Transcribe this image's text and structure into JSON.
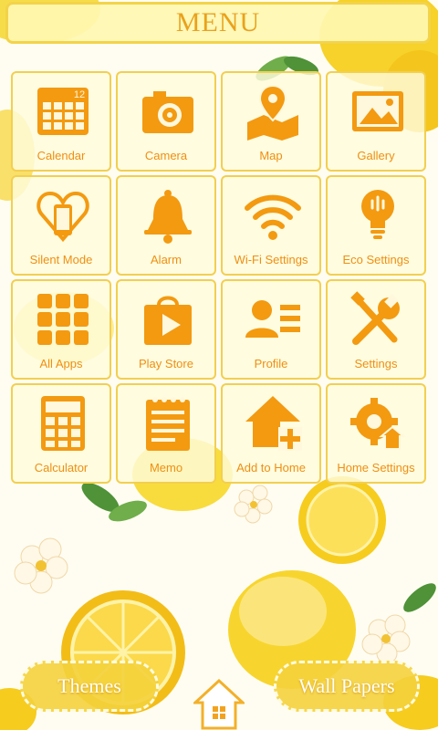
{
  "header": {
    "title": "MENU"
  },
  "apps": [
    {
      "label": "Calendar",
      "icon": "calendar-icon",
      "badge": "12"
    },
    {
      "label": "Camera",
      "icon": "camera-icon"
    },
    {
      "label": "Map",
      "icon": "map-icon"
    },
    {
      "label": "Gallery",
      "icon": "gallery-icon"
    },
    {
      "label": "Silent Mode",
      "icon": "silent-mode-icon"
    },
    {
      "label": "Alarm",
      "icon": "alarm-icon"
    },
    {
      "label": "Wi-Fi Settings",
      "icon": "wifi-icon"
    },
    {
      "label": "Eco Settings",
      "icon": "eco-bulb-icon"
    },
    {
      "label": "All Apps",
      "icon": "all-apps-icon"
    },
    {
      "label": "Play Store",
      "icon": "play-store-icon"
    },
    {
      "label": "Profile",
      "icon": "profile-icon"
    },
    {
      "label": "Settings",
      "icon": "settings-icon"
    },
    {
      "label": "Calculator",
      "icon": "calculator-icon"
    },
    {
      "label": "Memo",
      "icon": "memo-icon"
    },
    {
      "label": "Add to Home",
      "icon": "add-to-home-icon"
    },
    {
      "label": "Home Settings",
      "icon": "home-settings-icon"
    }
  ],
  "footer": {
    "themes_label": "Themes",
    "wallpapers_label": "Wall Papers",
    "home_icon": "home-icon"
  },
  "colors": {
    "icon_orange": "#f39a11",
    "tile_border": "#f2cf4f",
    "label_orange": "#ef8f10",
    "lemon_yellow": "#f7d52e"
  }
}
